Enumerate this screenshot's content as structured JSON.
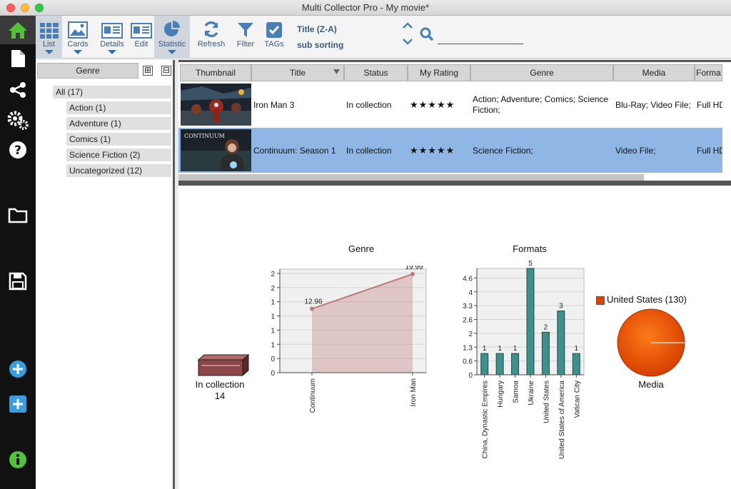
{
  "window": {
    "title": "Multi Collector Pro - My movie*"
  },
  "toolbar": {
    "list": "List",
    "cards": "Cards",
    "details": "Details",
    "edit": "Edit",
    "statistic": "Statistic",
    "refresh": "Refresh",
    "filter": "Filter",
    "tags": "TAGs",
    "sort_primary": "Title (Z-A)",
    "sort_secondary": "sub sorting",
    "search_value": ""
  },
  "genre_panel": {
    "header": "Genre",
    "expand_symbol": "⊞",
    "collapse_symbol": "⊟",
    "all": "All (17)",
    "items": [
      "Action (1)",
      "Adventure (1)",
      "Comics (1)",
      "Science Fiction (2)",
      "Uncategorized (12)"
    ]
  },
  "table": {
    "columns": [
      "Thumbnail",
      "Title",
      "Status",
      "My Rating",
      "Genre",
      "Media",
      "Forma"
    ],
    "rows": [
      {
        "title": "Iron Man 3",
        "status": "In collection",
        "rating": "★★★★★",
        "genre": "Action; Adventure; Comics; Science Fiction;",
        "media": "Blu-Ray; Video File;",
        "format": "Full HD",
        "selected": false
      },
      {
        "title": "Continuum: Season 1",
        "status": "In collection",
        "rating": "★★★★★",
        "genre": "Science Fiction;",
        "media": "Video File;",
        "format": "Full HD",
        "selected": true
      }
    ],
    "continuum_thumb_text": "CONTINUUM"
  },
  "stats": {
    "collection": {
      "label": "In collection",
      "value": "14"
    },
    "media": {
      "label": "Media",
      "legend": "United States (130)",
      "color": "#dd4400"
    }
  },
  "chart_data": [
    {
      "type": "area",
      "title": "Genre",
      "categories": [
        "Continuum",
        "Iron Man"
      ],
      "values": [
        12.96,
        19.99
      ],
      "data_labels": [
        "12.96",
        "19.99"
      ],
      "y_ticks": [
        "0",
        "0",
        "1",
        "1",
        "1",
        "1",
        "2",
        "2"
      ],
      "color": "#c07878"
    },
    {
      "type": "bar",
      "title": "Formats",
      "categories": [
        "China, Dynastic Empires",
        "Hungary",
        "Samoa",
        "Ukraine",
        "United States",
        "United States of America",
        "Vatican City"
      ],
      "values": [
        1,
        1,
        1,
        5,
        2,
        3,
        1
      ],
      "y_ticks": [
        "0",
        "0.6",
        "1.3",
        "2",
        "2.6",
        "3.3",
        "4",
        "4.6"
      ],
      "ylim": [
        0,
        5
      ],
      "color": "#3f8f8c"
    }
  ]
}
